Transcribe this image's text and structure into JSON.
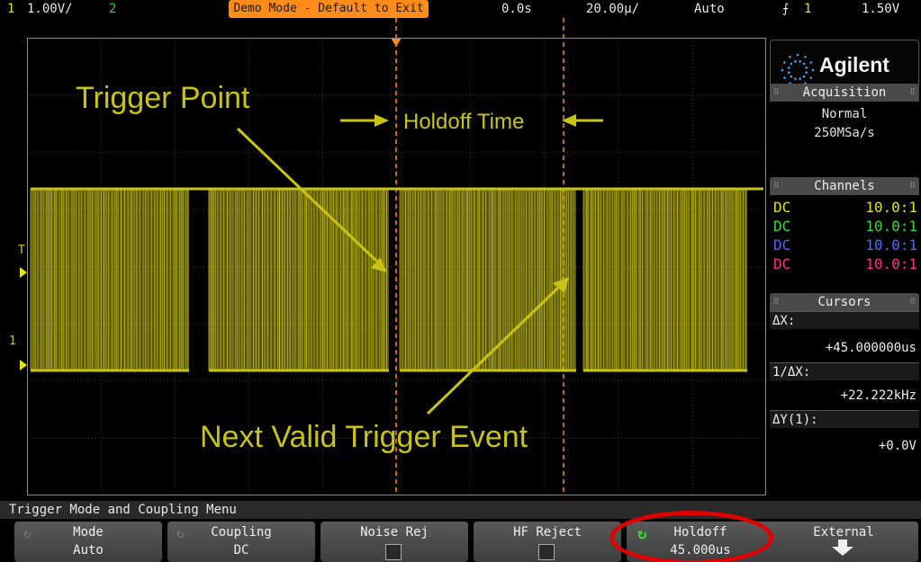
{
  "topbar": {
    "ch1_num": "1",
    "ch1_scale": "1.00V/",
    "ch2_num": "2",
    "demo_banner": "Demo Mode - Default to Exit",
    "time_delay": "0.0s",
    "time_scale": "20.00µ/",
    "trigger_mode": "Auto",
    "trigger_slope_icon": "rising-edge-icon",
    "trigger_ch": "1",
    "trigger_level": "1.50V"
  },
  "screen": {
    "annotations": {
      "trigger_point": "Trigger Point",
      "holdoff_time": "Holdoff Time",
      "next_valid": "Next Valid Trigger Event"
    },
    "markers": {
      "trigger_marker": "T",
      "ground_marker": "1"
    }
  },
  "right_panel": {
    "brand": "Agilent",
    "acquisition": {
      "title": "Acquisition",
      "mode": "Normal",
      "rate": "250MSa/s"
    },
    "channels": {
      "title": "Channels",
      "rows": [
        {
          "coupling": "DC",
          "probe": "10.0:1",
          "color": "#e6e600"
        },
        {
          "coupling": "DC",
          "probe": "10.0:1",
          "color": "#33dd33"
        },
        {
          "coupling": "DC",
          "probe": "10.0:1",
          "color": "#4a6cff"
        },
        {
          "coupling": "DC",
          "probe": "10.0:1",
          "color": "#ff2d8a"
        }
      ]
    },
    "cursors": {
      "title": "Cursors",
      "dx_label": "ΔX:",
      "dx_value": "+45.000000us",
      "inv_dx_label": "1/ΔX:",
      "inv_dx_value": "+22.222kHz",
      "dy_label": "ΔY(1):",
      "dy_value": "+0.0V"
    }
  },
  "menu": {
    "title": "Trigger Mode and Coupling Menu",
    "softkeys": [
      {
        "label": "Mode",
        "value": "Auto"
      },
      {
        "label": "Coupling",
        "value": "DC"
      },
      {
        "label": "Noise Rej",
        "value": ""
      },
      {
        "label": "HF Reject",
        "value": ""
      },
      {
        "label": "Holdoff",
        "value": "45.000us"
      },
      {
        "label": "External",
        "value": ""
      }
    ]
  },
  "colors": {
    "trace": "#c9c316",
    "demo_banner": "#ff8c1a",
    "cursor": "#ff8c1a",
    "highlight": "#e00000"
  }
}
